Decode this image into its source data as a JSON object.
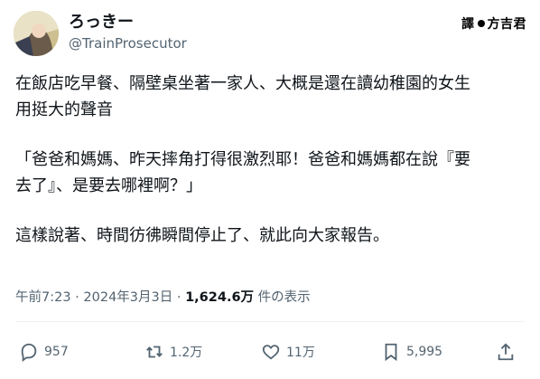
{
  "tweet": {
    "display_name": "ろっきー",
    "handle": "@TrainProsecutor",
    "watermark_left": "譯",
    "watermark_right": "方吉君",
    "text": {
      "line1": "在飯店吃早餐、隔壁桌坐著一家人、大概是還在讀幼稚園的女生",
      "line2": "用挺大的聲音",
      "line3": "「爸爸和媽媽、昨天摔角打得很激烈耶！爸爸和媽媽都在說『要",
      "line4": "去了』、是要去哪裡啊？」",
      "line5": "這樣說著、時間彷彿瞬間停止了、就此向大家報告。"
    },
    "meta": {
      "time": "午前7:23",
      "sep": "·",
      "date": "2024年3月3日",
      "sep2": "·",
      "views": "1,624.6万",
      "views_label": "件の表示"
    },
    "actions": {
      "reply_count": "957",
      "retweet_count": "1.2万",
      "like_count": "11万",
      "bookmark_count": "5,995"
    }
  }
}
